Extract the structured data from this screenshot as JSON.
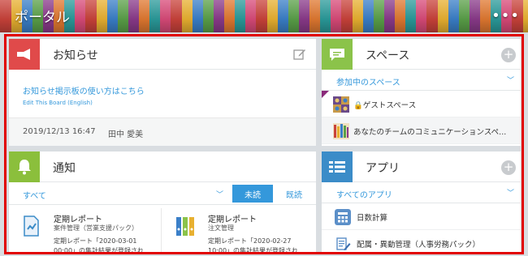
{
  "header": {
    "title": "ポータル",
    "menu_icon": "more-dots-icon"
  },
  "notice": {
    "title": "お知らせ",
    "link": "お知らせ掲示板の使い方はこちら",
    "sublink": "Edit This Board (English)",
    "date": "2019/12/13 16:47",
    "author": "田中 愛美"
  },
  "notifications": {
    "title": "通知",
    "filter": "すべて",
    "tab_unread": "未読",
    "tab_read": "既読",
    "items": [
      {
        "title": "定期レポート",
        "app": "案件管理（営業支援パック）",
        "body1": "定期レポート「2020-03-01",
        "body2": "00:00」の集計結果が登録され"
      },
      {
        "title": "定期レポート",
        "app": "注文管理",
        "body1": "定期レポート「2020-02-27",
        "body2": "10:00」の集計結果が登録され"
      }
    ]
  },
  "space": {
    "title": "スペース",
    "filter": "参加中のスペース",
    "items": [
      {
        "label": "🔒ゲストスペース"
      },
      {
        "label": "あなたのチームのコミュニケーションスペ..."
      }
    ]
  },
  "apps": {
    "title": "アプリ",
    "filter": "すべてのアプリ",
    "items": [
      {
        "label": "日数計算"
      },
      {
        "label": "配属・異動管理（人事労務パック）"
      }
    ]
  },
  "colors": {
    "accent": "#3498db",
    "frame": "#e10000",
    "notice_icon": "#e04a4a",
    "notify_icon": "#8bbf3c",
    "space_icon": "#8bc34a",
    "apps_icon": "#3b8cc8"
  }
}
